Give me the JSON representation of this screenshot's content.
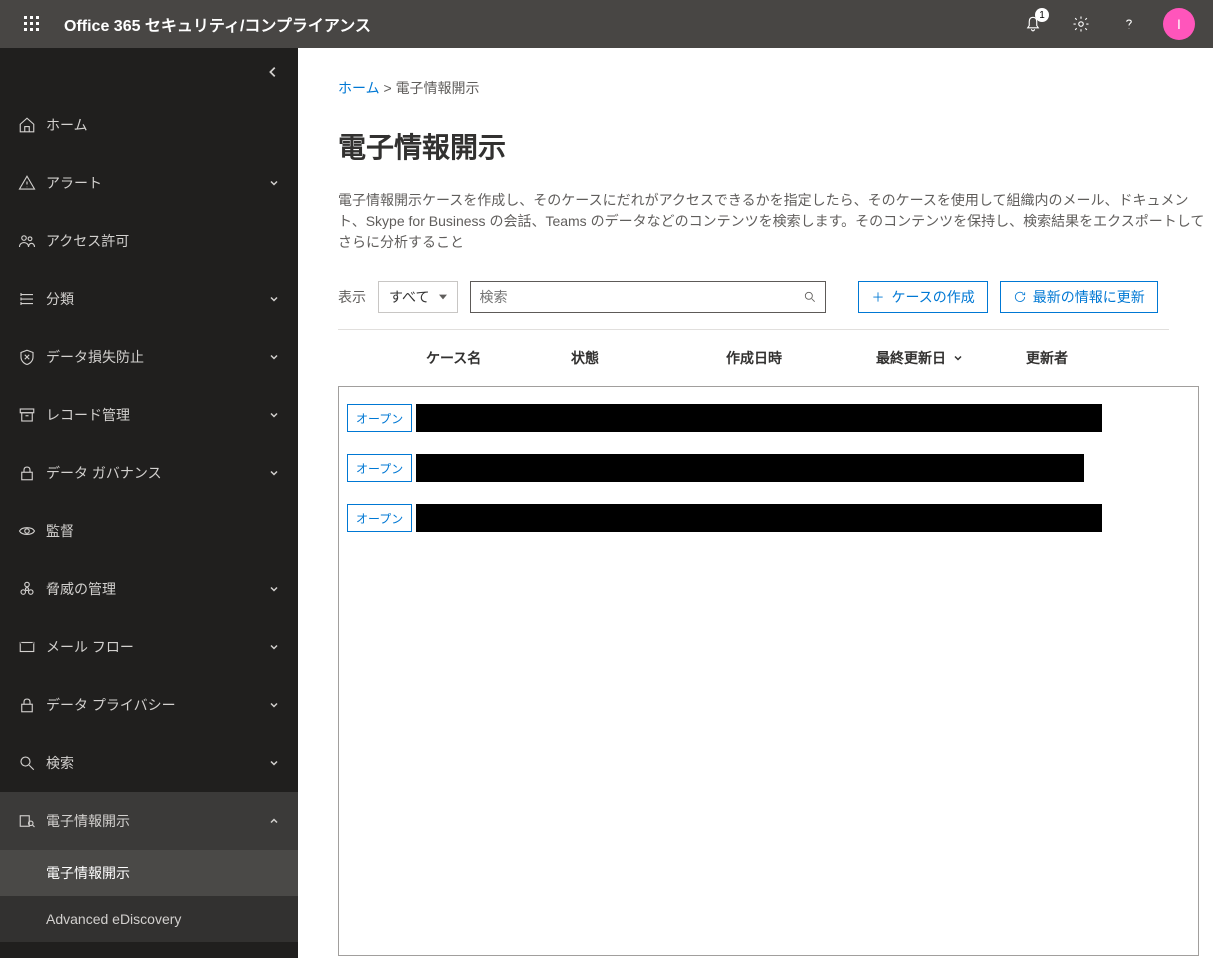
{
  "header": {
    "brand": "Office 365 セキュリティ/コンプライアンス",
    "notification_count": "1",
    "avatar_initial": "I"
  },
  "sidebar": {
    "items": [
      {
        "label": "ホーム",
        "expandable": false
      },
      {
        "label": "アラート",
        "expandable": true
      },
      {
        "label": "アクセス許可",
        "expandable": false
      },
      {
        "label": "分類",
        "expandable": true
      },
      {
        "label": "データ損失防止",
        "expandable": true
      },
      {
        "label": "レコード管理",
        "expandable": true
      },
      {
        "label": "データ ガバナンス",
        "expandable": true
      },
      {
        "label": "監督",
        "expandable": false
      },
      {
        "label": "脅威の管理",
        "expandable": true
      },
      {
        "label": "メール フロー",
        "expandable": true
      },
      {
        "label": "データ プライバシー",
        "expandable": true
      },
      {
        "label": "検索",
        "expandable": true
      },
      {
        "label": "電子情報開示",
        "expandable": true,
        "expanded": true
      }
    ],
    "subitems": [
      {
        "label": "電子情報開示",
        "selected": true
      },
      {
        "label": "Advanced eDiscovery",
        "selected": false
      }
    ]
  },
  "breadcrumb": {
    "home": "ホーム",
    "sep": ">",
    "current": "電子情報開示"
  },
  "page": {
    "title": "電子情報開示",
    "description": "電子情報開示ケースを作成し、そのケースにだれがアクセスできるかを指定したら、そのケースを使用して組織内のメール、ドキュメント、Skype for Business の会話、Teams のデータなどのコンテンツを検索します。そのコンテンツを保持し、検索結果をエクスポートしてさらに分析すること"
  },
  "toolbar": {
    "show_label": "表示",
    "dropdown_value": "すべて",
    "search_placeholder": "検索",
    "create_label": "ケースの作成",
    "refresh_label": "最新の情報に更新"
  },
  "table": {
    "columns": {
      "name": "ケース名",
      "state": "状態",
      "created": "作成日時",
      "updated": "最終更新日",
      "updater": "更新者"
    },
    "open_label": "オープン",
    "rows": [
      {
        "open": "オープン"
      },
      {
        "open": "オープン"
      },
      {
        "open": "オープン"
      }
    ]
  }
}
